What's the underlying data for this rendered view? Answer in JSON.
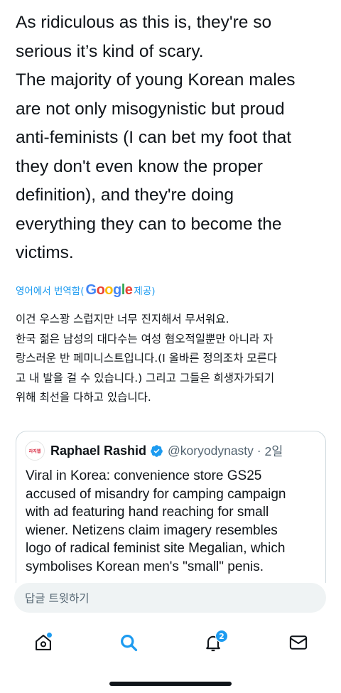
{
  "tweet": {
    "text": "As ridiculous as this is, they're so\nserious it’s kind of scary.\nThe majority of young Korean males\nare not only misogynistic but proud\nanti-feminists (I can bet my foot that\nthey don't even know the proper\ndefinition), and they're doing\neverything they can to become the\nvictims."
  },
  "translation": {
    "prefix": "영어에서 번역함(",
    "google_letters": [
      "G",
      "o",
      "o",
      "g",
      "l",
      "e"
    ],
    "suffix": " 제공)",
    "text": "이건 우스꽝 스럽지만 너무 진지해서 무서워요.\n 한국 젊은 남성의 대다수는 여성 혐오적일뿐만 아니라 자\n랑스러운 반 페미니스트입니다.(I 올바른 정의조차 모른다\n고 내 발을 걸 수 있습니다.) 그리고 그들은 희생자가되기\n위해 최선을 다하고 있습니다."
  },
  "quote": {
    "avatar_text": "라지웹",
    "name": "Raphael Rashid",
    "verified_icon": "verified-badge-icon",
    "handle": "@koryodynasty",
    "time": "2일",
    "text": "Viral in Korea: convenience store GS25\naccused of misandry for camping campaign\nwith ad featuring hand reaching for small\nwiener. Netizens claim imagery resembles\nlogo of radical feminist site Megalian, which\nsymbolises Korean men's \"small\" penis."
  },
  "reply": {
    "placeholder": "답글 트윗하기"
  },
  "tabbar": {
    "items": [
      {
        "icon": "home-icon",
        "has_dot": true
      },
      {
        "icon": "search-icon",
        "active": true
      },
      {
        "icon": "notifications-bell-icon",
        "badge": "2"
      },
      {
        "icon": "messages-envelope-icon"
      }
    ]
  },
  "colors": {
    "accent": "#1d9bf0",
    "text": "#0f1419",
    "secondary": "#536471",
    "border": "#cfd9de",
    "input_bg": "#eff3f4"
  }
}
